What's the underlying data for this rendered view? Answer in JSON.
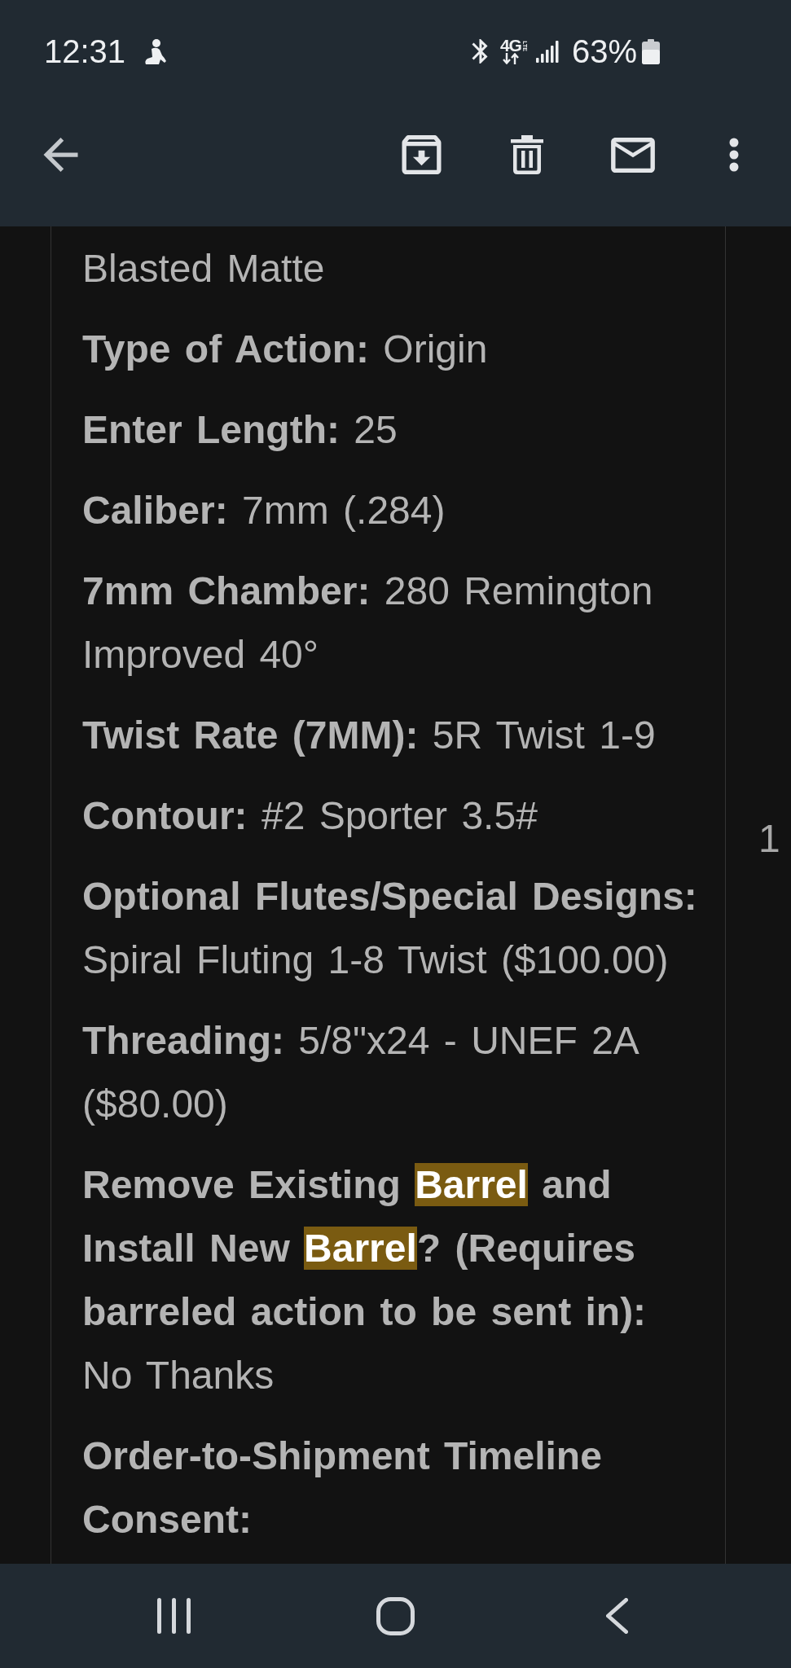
{
  "status_bar": {
    "time": "12:31",
    "network": {
      "type": "4G",
      "subtype": "LTE"
    },
    "battery": "63%"
  },
  "order_table": {
    "column_1": {
      "paragraphs": [
        {
          "value": "Blasted Matte"
        },
        {
          "label": "Type of Action:",
          "value": "Origin"
        },
        {
          "label": "Enter Length:",
          "value": "25"
        },
        {
          "label": "Caliber:",
          "value": "7mm (.284)"
        },
        {
          "label": "7mm Chamber:",
          "value": "280 Remington Improved 40°"
        },
        {
          "label": "Twist Rate (7MM):",
          "value": "5R Twist 1-9"
        },
        {
          "label": "Contour:",
          "value": "#2 Sporter 3.5#"
        },
        {
          "label": "Optional Flutes/Special Designs:",
          "value": "Spiral Fluting 1-8 Twist ($100.00)"
        },
        {
          "label": "Threading:",
          "value": "5/8\"x24 - UNEF 2A ($80.00)"
        },
        {
          "label_parts": [
            {
              "text": "Remove Existing ",
              "highlighted": false
            },
            {
              "text": "Barrel",
              "highlighted": true
            },
            {
              "text": " and Install New ",
              "highlighted": false
            },
            {
              "text": "Barrel",
              "highlighted": true
            },
            {
              "text": "? (Requires barreled action to be sent in):",
              "highlighted": false
            }
          ],
          "value": "No Thanks"
        },
        {
          "label": "Order-to-Shipment Timeline Consent:"
        }
      ]
    },
    "column_2": {
      "cell": "1"
    }
  }
}
